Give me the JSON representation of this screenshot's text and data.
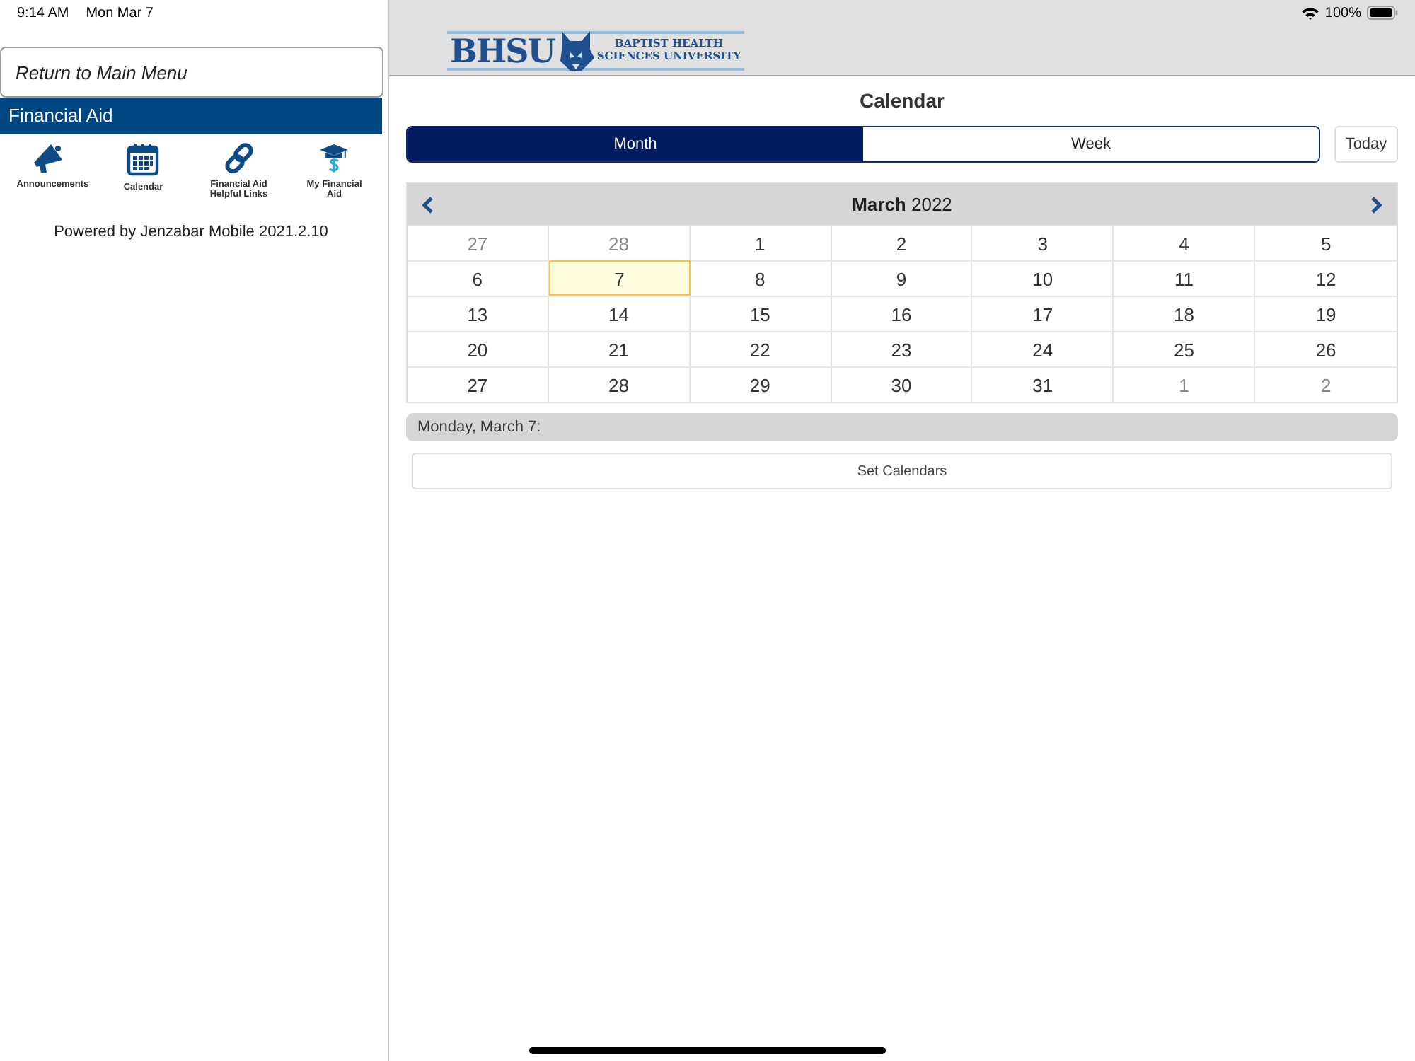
{
  "status_bar": {
    "time": "9:14 AM",
    "date": "Mon Mar 7",
    "battery": "100%"
  },
  "sidebar": {
    "return_button": "Return to Main Menu",
    "section_title": "Financial Aid",
    "items": [
      {
        "label": "Announcements",
        "kind": "megaphone"
      },
      {
        "label": "Calendar",
        "kind": "calendar"
      },
      {
        "label": "Financial Aid Helpful Links",
        "kind": "link"
      },
      {
        "label": "My Financial Aid",
        "kind": "grad"
      }
    ],
    "footer": "Powered by Jenzabar Mobile 2021.2.10"
  },
  "header": {
    "logo": {
      "abbr": "BHSU",
      "line_1": "BAPTIST HEALTH",
      "line_2": "SCIENCES UNIVERSITY"
    }
  },
  "page_title": "Calendar",
  "view_tabs": [
    {
      "label": "Month",
      "selected": true
    },
    {
      "label": "Week",
      "selected": false
    }
  ],
  "today_button": "Today",
  "calendar": {
    "month_title": "**March** 2022",
    "days": [
      {
        "label": "27",
        "outside": true,
        "selected": false
      },
      {
        "label": "28",
        "outside": true,
        "selected": false
      },
      {
        "label": "1",
        "outside": false,
        "selected": false
      },
      {
        "label": "2",
        "outside": false,
        "selected": false
      },
      {
        "label": "3",
        "outside": false,
        "selected": false
      },
      {
        "label": "4",
        "outside": false,
        "selected": false
      },
      {
        "label": "5",
        "outside": false,
        "selected": false
      },
      {
        "label": "6",
        "outside": false,
        "selected": false
      },
      {
        "label": "7",
        "outside": false,
        "selected": true
      },
      {
        "label": "8",
        "outside": false,
        "selected": false
      },
      {
        "label": "9",
        "outside": false,
        "selected": false
      },
      {
        "label": "10",
        "outside": false,
        "selected": false
      },
      {
        "label": "11",
        "outside": false,
        "selected": false
      },
      {
        "label": "12",
        "outside": false,
        "selected": false
      },
      {
        "label": "13",
        "outside": false,
        "selected": false
      },
      {
        "label": "14",
        "outside": false,
        "selected": false
      },
      {
        "label": "15",
        "outside": false,
        "selected": false
      },
      {
        "label": "16",
        "outside": false,
        "selected": false
      },
      {
        "label": "17",
        "outside": false,
        "selected": false
      },
      {
        "label": "18",
        "outside": false,
        "selected": false
      },
      {
        "label": "19",
        "outside": false,
        "selected": false
      },
      {
        "label": "20",
        "outside": false,
        "selected": false
      },
      {
        "label": "21",
        "outside": false,
        "selected": false
      },
      {
        "label": "22",
        "outside": false,
        "selected": false
      },
      {
        "label": "23",
        "outside": false,
        "selected": false
      },
      {
        "label": "24",
        "outside": false,
        "selected": false
      },
      {
        "label": "25",
        "outside": false,
        "selected": false
      },
      {
        "label": "26",
        "outside": false,
        "selected": false
      },
      {
        "label": "27",
        "outside": false,
        "selected": false
      },
      {
        "label": "28",
        "outside": false,
        "selected": false
      },
      {
        "label": "29",
        "outside": false,
        "selected": false
      },
      {
        "label": "30",
        "outside": false,
        "selected": false
      },
      {
        "label": "31",
        "outside": false,
        "selected": false
      },
      {
        "label": "1",
        "outside": true,
        "selected": false
      },
      {
        "label": "2",
        "outside": true,
        "selected": false
      }
    ]
  },
  "day_heading": "Monday, March 7:",
  "set_calendars_button": "Set Calendars"
}
